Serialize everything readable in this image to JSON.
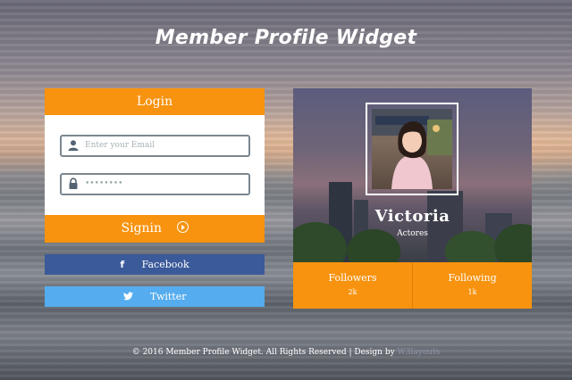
{
  "page": {
    "title": "Member Profile Widget"
  },
  "login": {
    "header": "Login",
    "email_placeholder": "Enter your Email",
    "password_value": "••••••••",
    "signin_label": "Signin"
  },
  "social": {
    "facebook_label": "Facebook",
    "twitter_label": "Twitter"
  },
  "profile": {
    "name": "Victoria",
    "role": "Actores",
    "stats": [
      {
        "label": "Followers",
        "value": "2k"
      },
      {
        "label": "Following",
        "value": "1k"
      }
    ]
  },
  "footer": {
    "text": "© 2016 Member Profile Widget. All Rights Reserved | Design by ",
    "brand": "W3layouts"
  },
  "colors": {
    "accent": "#f7930f",
    "facebook": "#3b5a9a",
    "twitter": "#55acee"
  },
  "icons": {
    "user": "user-icon",
    "lock": "lock-icon",
    "arrow": "arrow-circle-right-icon",
    "facebook": "facebook-icon",
    "twitter": "twitter-icon"
  }
}
